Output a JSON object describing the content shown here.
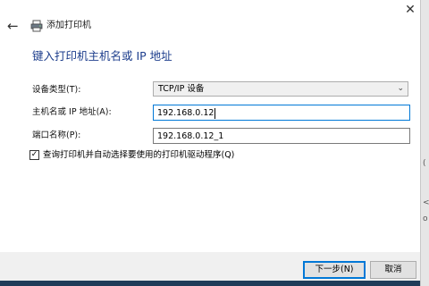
{
  "window": {
    "title": "添加打印机",
    "back_glyph": "←",
    "close_glyph": "✕"
  },
  "heading": "键入打印机主机名或 IP 地址",
  "form": {
    "device_type_label": "设备类型(T):",
    "device_type_value": "TCP/IP 设备",
    "host_label": "主机名或 IP 地址(A):",
    "host_value": "192.168.0.12",
    "port_label": "端口名称(P):",
    "port_value": "192.168.0.12_1",
    "query_checkbox_label": "查询打印机并自动选择要使用的打印机驱动程序(Q)",
    "query_checkbox_checked": true,
    "query_checkbox_mark": "✓"
  },
  "footer": {
    "next_label": "下一步(N)",
    "cancel_label": "取消"
  },
  "background_strip": {
    "marks": [
      "(",
      "<",
      "o"
    ]
  },
  "colors": {
    "accent": "#0078d7",
    "heading": "#1c3d8c"
  },
  "icons": {
    "back": "back-arrow-icon",
    "printer": "printer-icon",
    "close": "close-icon",
    "dropdown": "chevron-down-icon"
  }
}
